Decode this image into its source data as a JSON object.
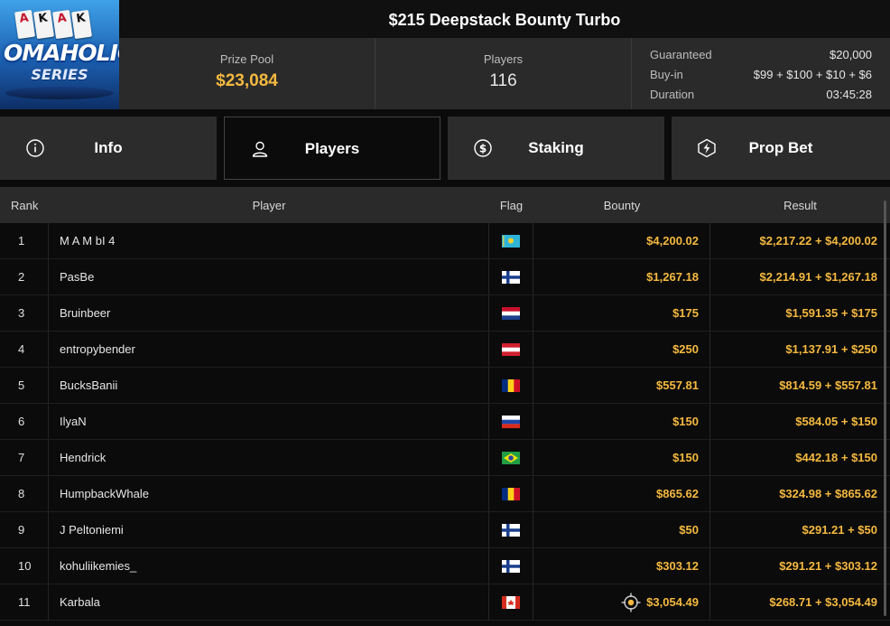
{
  "logo": {
    "card_letters": [
      "A",
      "K",
      "A",
      "K"
    ],
    "line1": "OMAHOLIC",
    "line2": "SERIES"
  },
  "title": "$215 Deepstack Bounty Turbo",
  "stats": {
    "prize_pool_label": "Prize Pool",
    "prize_pool_value": "$23,084",
    "players_label": "Players",
    "players_value": "116"
  },
  "details": [
    {
      "label": "Guaranteed",
      "value": "$20,000"
    },
    {
      "label": "Buy-in",
      "value": "$99 + $100 + $10 + $6"
    },
    {
      "label": "Duration",
      "value": "03:45:28"
    }
  ],
  "tabs": [
    {
      "label": "Info",
      "icon": "info-icon",
      "active": false
    },
    {
      "label": "Players",
      "icon": "user-icon",
      "active": true
    },
    {
      "label": "Staking",
      "icon": "dollar-coin-icon",
      "active": false
    },
    {
      "label": "Prop Bet",
      "icon": "lightning-icon",
      "active": false
    }
  ],
  "table": {
    "headers": {
      "rank": "Rank",
      "player": "Player",
      "flag": "Flag",
      "bounty": "Bounty",
      "result": "Result"
    },
    "rows": [
      {
        "rank": "1",
        "player": "M A M bI 4",
        "flag": "kazakhstan",
        "bounty": "$4,200.02",
        "result": "$2,217.22 + $4,200.02"
      },
      {
        "rank": "2",
        "player": "PasBe",
        "flag": "finland",
        "bounty": "$1,267.18",
        "result": "$2,214.91 + $1,267.18"
      },
      {
        "rank": "3",
        "player": "Bruinbeer",
        "flag": "netherlands",
        "bounty": "$175",
        "result": "$1,591.35 + $175"
      },
      {
        "rank": "4",
        "player": "entropybender",
        "flag": "austria",
        "bounty": "$250",
        "result": "$1,137.91 + $250"
      },
      {
        "rank": "5",
        "player": "BucksBanii",
        "flag": "romania",
        "bounty": "$557.81",
        "result": "$814.59 + $557.81"
      },
      {
        "rank": "6",
        "player": "IlyaN",
        "flag": "russia",
        "bounty": "$150",
        "result": "$584.05 + $150"
      },
      {
        "rank": "7",
        "player": "Hendrick",
        "flag": "brazil",
        "bounty": "$150",
        "result": "$442.18 + $150"
      },
      {
        "rank": "8",
        "player": "HumpbackWhale",
        "flag": "romania",
        "bounty": "$865.62",
        "result": "$324.98 + $865.62"
      },
      {
        "rank": "9",
        "player": "J Peltoniemi",
        "flag": "finland",
        "bounty": "$50",
        "result": "$291.21 + $50"
      },
      {
        "rank": "10",
        "player": "kohuliikemies_",
        "flag": "finland",
        "bounty": "$303.12",
        "result": "$291.21 + $303.12"
      },
      {
        "rank": "11",
        "player": "Karbala",
        "flag": "canada",
        "bounty": "$3,054.49",
        "result": "$268.71 + $3,054.49",
        "bounty_icon": "target-crosshair-icon"
      }
    ]
  },
  "colors": {
    "accent_gold": "#f5b940",
    "panel": "#2a2a2a",
    "background": "#0b0b0b"
  }
}
